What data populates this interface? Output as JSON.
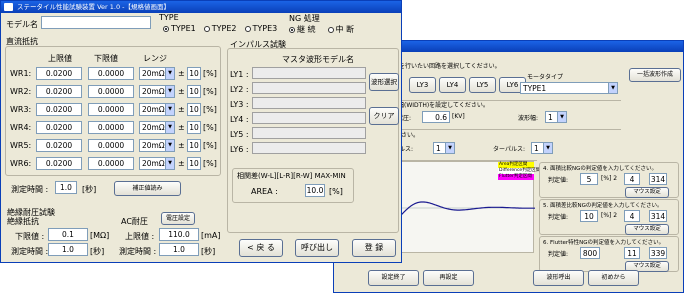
{
  "win1": {
    "title": "ステータイル性能試験装置 Ver 1.0 -【規格値画面】",
    "model_label": "モデル名",
    "model_value": "",
    "type": {
      "heading": "TYPE",
      "options": [
        "TYPE1",
        "TYPE2",
        "TYPE3"
      ],
      "selected": 0
    },
    "ng": {
      "heading": "NG 処理",
      "options": [
        "継 続",
        "中 断"
      ],
      "selected": 0
    },
    "dc": {
      "heading": "直流抵抗",
      "col_upper": "上限値",
      "col_lower": "下限値",
      "col_range": "レンジ",
      "pm": "±",
      "unit": "[%]",
      "rows": [
        {
          "label": "WR1:",
          "upper": "0.0200",
          "lower": "0.0000",
          "range": "20mΩ",
          "tol": "10"
        },
        {
          "label": "WR2:",
          "upper": "0.0200",
          "lower": "0.0000",
          "range": "20mΩ",
          "tol": "10"
        },
        {
          "label": "WR3:",
          "upper": "0.0200",
          "lower": "0.0000",
          "range": "20mΩ",
          "tol": "10"
        },
        {
          "label": "WR4:",
          "upper": "0.0200",
          "lower": "0.0000",
          "range": "20mΩ",
          "tol": "10"
        },
        {
          "label": "WR5:",
          "upper": "0.0200",
          "lower": "0.0000",
          "range": "20mΩ",
          "tol": "10"
        },
        {
          "label": "WR6:",
          "upper": "0.0200",
          "lower": "0.0000",
          "range": "20mΩ",
          "tol": "10"
        }
      ]
    },
    "measure_time_label": "測定時間 :",
    "measure_time": "1.0",
    "measure_time_unit": "[秒]",
    "read_btn": "補正値読み",
    "ins": {
      "heading": "絶縁耐圧試験",
      "res_heading": "絶縁抵抗",
      "lower_label": "下限値 :",
      "lower": "0.1",
      "lower_unit": "[MΩ]",
      "time_label": "測定時間 :",
      "time": "1.0",
      "time_unit": "[秒]",
      "ac_heading": "AC耐圧",
      "ac_btn": "電圧設定",
      "upper_label": "上限値 :",
      "upper": "110.0",
      "upper_unit": "[mA]",
      "ac_time_label": "測定時間 :",
      "ac_time": "1.0",
      "ac_time_unit": "[秒]"
    },
    "impulse": {
      "heading": "インパルス試験",
      "master_label": "マスタ波形モデル名",
      "ly": [
        "LY1 :",
        "LY2 :",
        "LY3 :",
        "LY4 :",
        "LY5 :",
        "LY6 :"
      ],
      "wave_btn": "波形選択",
      "clear_btn": "クリア",
      "diff_heading": "相関差(W-L][L-R][R-W] MAX-MIN",
      "area_label": "AREA :",
      "area": "10.0",
      "area_unit": "[%]"
    },
    "back_btn": "< 戻 る",
    "call_btn": "呼び出し",
    "register_btn": "登 録"
  },
  "win2": {
    "title": "r 1.0 -【波形設定】",
    "msg1": "形を行いたい回路を選択してください。",
    "ly_btns": [
      "LY3",
      "LY4",
      "LY5",
      "LY6"
    ],
    "motor_label": "モータタイプ",
    "motor_value": "TYPE1",
    "batch_btn": "一括波形作成",
    "msg2": "形幅(WIDTH)を設定してください。",
    "voltage_label": "電圧:",
    "voltage": "0.6",
    "voltage_unit": "[KV]",
    "width_label": "波形幅:",
    "width": "1",
    "msg3": "ください。",
    "pulse_label": "パルス:",
    "pulse": "1",
    "delay_label": "ターパルス:",
    "delay": "1",
    "legend": [
      "Area判定区間",
      "Difference判定区間",
      "Flutter判定区間"
    ],
    "legend_colors": [
      "#ffff00",
      "#ffffff",
      "#ff00ff"
    ],
    "sec1": {
      "title": "4. 面積比較NGの判定値を入力してください。",
      "label": "判定値:",
      "v1": "5",
      "mid": "[%] 2",
      "v2": "4",
      "v3": "314",
      "btn": "マウス設定"
    },
    "sec2": {
      "title": "5. 面積差比較NGの判定値を入力してください。",
      "label": "判定値:",
      "v1": "10",
      "mid": "[%] 2",
      "v2": "4",
      "v3": "314",
      "btn": "マウス設定"
    },
    "sec3": {
      "title": "6. Flutter特性NGの判定値を入力してください。",
      "label": "判定値:",
      "v1": "800",
      "v2": "11",
      "v3": "339",
      "btn": "マウス設定"
    },
    "end_btn": "設定終了",
    "reset_btn": "再設定",
    "wave_call_btn": "波形呼出",
    "restart_btn": "初めから"
  }
}
